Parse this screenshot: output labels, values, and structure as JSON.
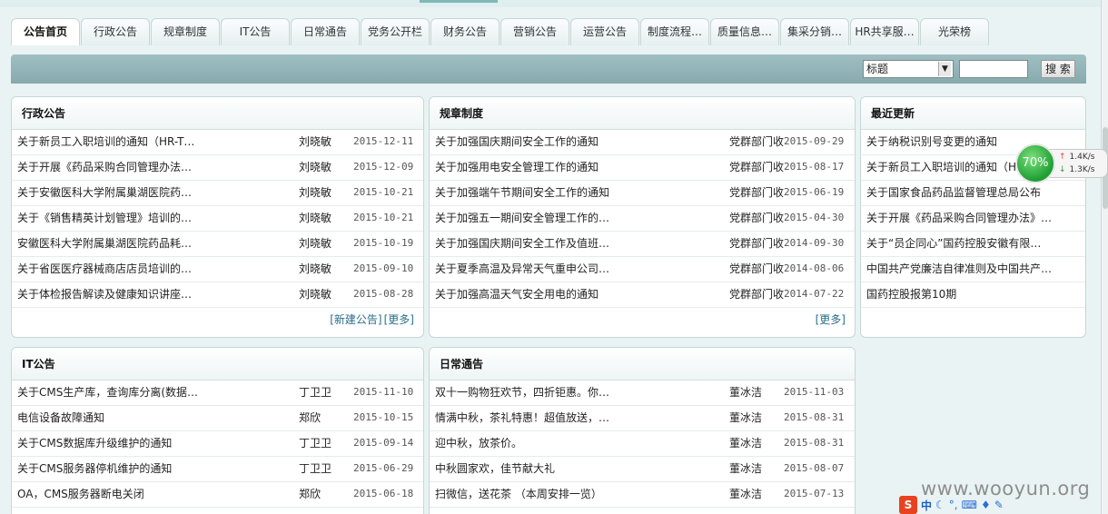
{
  "tabs": [
    "公告首页",
    "行政公告",
    "规章制度",
    "IT公告",
    "日常通告",
    "党务公开栏",
    "财务公告",
    "营销公告",
    "运营公告",
    "制度流程…",
    "质量信息…",
    "集采分销…",
    "HR共享服…",
    "光荣榜"
  ],
  "search": {
    "field_label": "标题",
    "button_label": "搜 索"
  },
  "panels": {
    "admin": {
      "title": "行政公告",
      "rows": [
        {
          "title": "关于新员工入职培训的通知（HR-T…",
          "author": "刘晓敏",
          "date": "2015-12-11"
        },
        {
          "title": "关于开展《药品采购合同管理办法…",
          "author": "刘晓敏",
          "date": "2015-12-09"
        },
        {
          "title": "关于安徽医科大学附属巢湖医院药…",
          "author": "刘晓敏",
          "date": "2015-10-21"
        },
        {
          "title": "关于《销售精英计划管理》培训的…",
          "author": "刘晓敏",
          "date": "2015-10-21"
        },
        {
          "title": "安徽医科大学附属巢湖医院药品耗…",
          "author": "刘晓敏",
          "date": "2015-10-19"
        },
        {
          "title": "关于省医医疗器械商店店员培训的…",
          "author": "刘晓敏",
          "date": "2015-09-10"
        },
        {
          "title": "关于体检报告解读及健康知识讲座…",
          "author": "刘晓敏",
          "date": "2015-08-28"
        }
      ],
      "new_label": "[新建公告]",
      "more_label": "[更多]"
    },
    "rules": {
      "title": "规章制度",
      "rows": [
        {
          "title": "关于加强国庆期间安全工作的通知",
          "author": "党群部门收",
          "date": "2015-09-29"
        },
        {
          "title": "关于加强用电安全管理工作的通知",
          "author": "党群部门收",
          "date": "2015-08-17"
        },
        {
          "title": "关于加强端午节期间安全工作的通知",
          "author": "党群部门收",
          "date": "2015-06-19"
        },
        {
          "title": "关于加强五一期间安全管理工作的…",
          "author": "党群部门收",
          "date": "2015-04-30"
        },
        {
          "title": "关于加强国庆期间安全工作及值班…",
          "author": "党群部门收",
          "date": "2014-09-30"
        },
        {
          "title": "关于夏季高温及异常天气重申公司…",
          "author": "党群部门收",
          "date": "2014-08-06"
        },
        {
          "title": "关于加强高温天气安全用电的通知",
          "author": "党群部门收",
          "date": "2014-07-22"
        }
      ],
      "more_label": "[更多]"
    },
    "recent": {
      "title": "最近更新",
      "rows": [
        "关于纳税识别号变更的通知",
        "关于新员工入职培训的通知（H",
        "关于国家食品药品监督管理总局公布",
        "关于开展《药品采购合同管理办法》…",
        "关于“员企同心”国药控股安徽有限…",
        "中国共产党廉洁自律准则及中国共产…",
        "国药控股报第10期"
      ]
    },
    "it": {
      "title": "IT公告",
      "rows": [
        {
          "title": "关于CMS生产库，查询库分离(数据…",
          "author": "丁卫卫",
          "date": "2015-11-10"
        },
        {
          "title": "电信设备故障通知",
          "author": "郑欣",
          "date": "2015-10-15"
        },
        {
          "title": "关于CMS数据库升级维护的通知",
          "author": "丁卫卫",
          "date": "2015-09-14"
        },
        {
          "title": "关于CMS服务器停机维护的通知",
          "author": "丁卫卫",
          "date": "2015-06-29"
        },
        {
          "title": "OA，CMS服务器断电关闭",
          "author": "郑欣",
          "date": "2015-06-18"
        }
      ]
    },
    "daily": {
      "title": "日常通告",
      "rows": [
        {
          "title": "双十一购物狂欢节，四折钜惠。你…",
          "author": "董冰洁",
          "date": "2015-11-03"
        },
        {
          "title": "情满中秋，茶礼特惠！超值放送，…",
          "author": "董冰洁",
          "date": "2015-08-31"
        },
        {
          "title": "迎中秋，放茶价。",
          "author": "董冰洁",
          "date": "2015-08-31"
        },
        {
          "title": "中秋圆家欢，佳节献大礼",
          "author": "董冰洁",
          "date": "2015-08-07"
        },
        {
          "title": "扫微信，送花茶 （本周安排一览）",
          "author": "董冰洁",
          "date": "2015-07-13"
        }
      ]
    }
  },
  "net_widget": {
    "percent_label": "70%",
    "up": "1.4K/s",
    "down": "1.3K/s",
    "percent_value": 70
  },
  "watermark": "www.wooyun.org",
  "ime": {
    "logo": "S",
    "mode": "中"
  }
}
